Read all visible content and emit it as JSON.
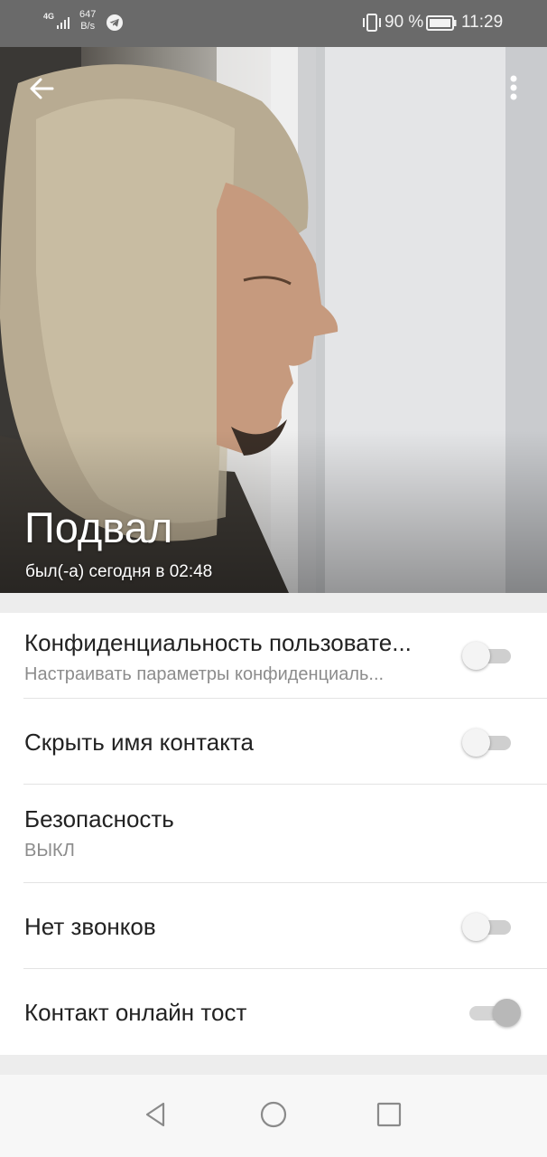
{
  "status_bar": {
    "network": "4G",
    "speed_value": "647",
    "speed_unit": "B/s",
    "battery_percent": "90 %",
    "time": "11:29",
    "icons": [
      "signal-icon",
      "telegram-icon",
      "vibrate-icon",
      "battery-icon"
    ]
  },
  "header": {
    "name": "Подвал",
    "last_seen": "был(-а) сегодня в 02:48",
    "icons": [
      "back-arrow-icon",
      "more-vert-icon"
    ]
  },
  "settings": [
    {
      "title": "Конфиденциальность пользовате...",
      "subtitle": "Настраивать параметры конфиденциаль...",
      "toggle": false
    },
    {
      "title": "Скрыть имя контакта",
      "toggle": false
    },
    {
      "title": "Безопасность",
      "subtitle": "ВЫКЛ"
    },
    {
      "title": "Нет звонков",
      "toggle": false
    },
    {
      "title": "Контакт онлайн тост",
      "toggle": true
    }
  ],
  "nav_bar": {
    "icons": [
      "nav-back-icon",
      "nav-home-icon",
      "nav-recents-icon"
    ]
  },
  "colors": {
    "status_bar_bg": "#6a6a6a",
    "settings_bg": "#ffffff",
    "toggle_off_track": "#cfcfcf",
    "toggle_on_thumb": "#b8b8b8"
  }
}
